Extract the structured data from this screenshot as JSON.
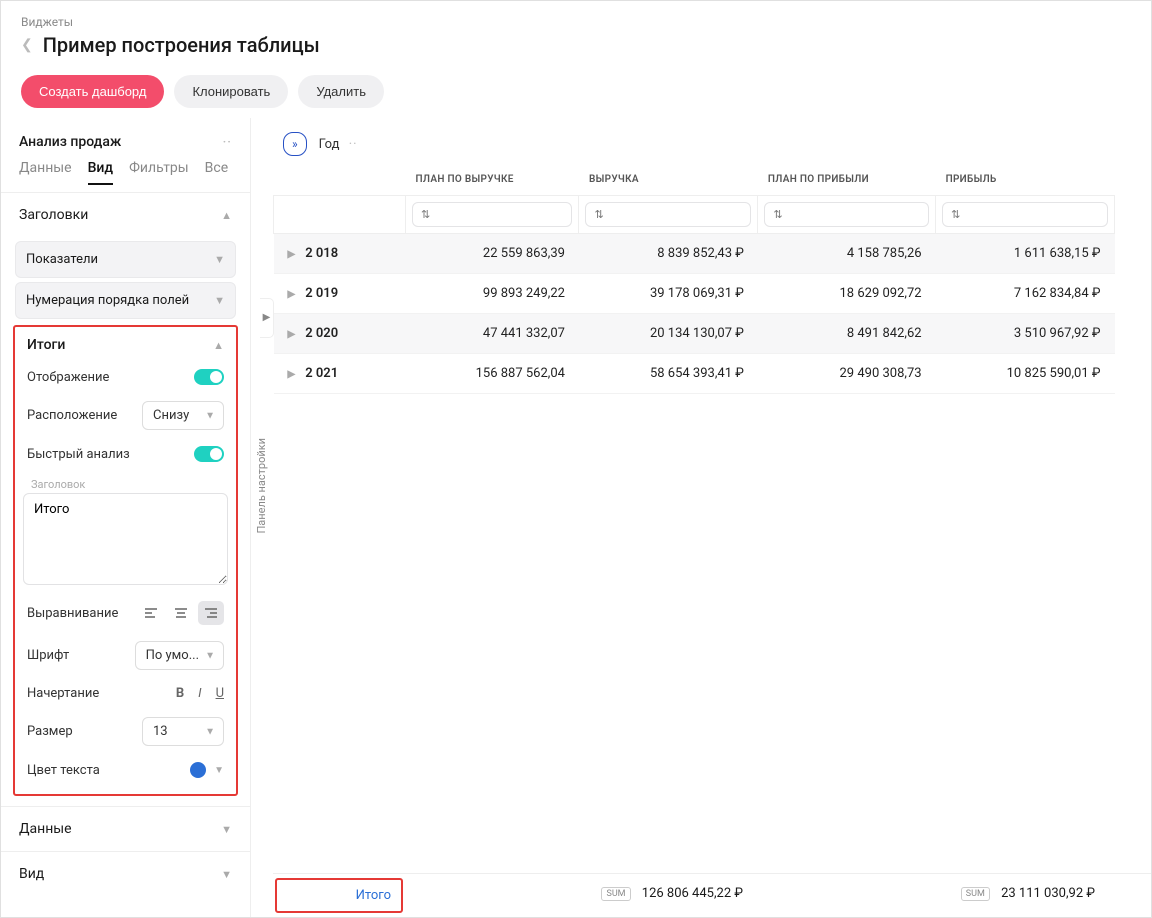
{
  "breadcrumb": "Виджеты",
  "page_title": "Пример построения таблицы",
  "buttons": {
    "create": "Создать дашборд",
    "clone": "Клонировать",
    "delete": "Удалить"
  },
  "sidebar": {
    "title": "Анализ продаж",
    "tabs": {
      "data": "Данные",
      "view": "Вид",
      "filters": "Фильтры",
      "all": "Все"
    },
    "sections": {
      "headers": "Заголовки",
      "measures": "Показатели",
      "numbering": "Нумерация порядка полей",
      "totals": "Итоги",
      "data": "Данные",
      "view2": "Вид"
    },
    "totals": {
      "display": "Отображение",
      "position": "Расположение",
      "position_value": "Снизу",
      "quick": "Быстрый анализ",
      "heading_label": "Заголовок",
      "heading_value": "Итого",
      "align": "Выравнивание",
      "font": "Шрифт",
      "font_value": "По умо...",
      "face": "Начертание",
      "size": "Размер",
      "size_value": "13",
      "text_color": "Цвет текста"
    }
  },
  "collapse_label": "Панель настройки",
  "toolbar": {
    "year": "Год"
  },
  "columns": {
    "plan_rev": "ПЛАН ПО ВЫРУЧКЕ",
    "rev": "ВЫРУЧКА",
    "plan_profit": "ПЛАН ПО ПРИБЫЛИ",
    "profit": "ПРИБЫЛЬ"
  },
  "rows": [
    {
      "year": "2 018",
      "c1": "22 559 863,39",
      "c2": "8 839 852,43 ₽",
      "c3": "4 158 785,26",
      "c4": "1 611 638,15 ₽"
    },
    {
      "year": "2 019",
      "c1": "99 893 249,22",
      "c2": "39 178 069,31 ₽",
      "c3": "18 629 092,72",
      "c4": "7 162 834,84 ₽"
    },
    {
      "year": "2 020",
      "c1": "47 441 332,07",
      "c2": "20 134 130,07 ₽",
      "c3": "8 491 842,62",
      "c4": "3 510 967,92 ₽"
    },
    {
      "year": "2 021",
      "c1": "156 887 562,04",
      "c2": "58 654 393,41 ₽",
      "c3": "29 490 308,73",
      "c4": "10 825 590,01 ₽"
    }
  ],
  "footer": {
    "label": "Итого",
    "sum_badge": "SUM",
    "rev_total": "126 806 445,22 ₽",
    "profit_total": "23 111 030,92 ₽"
  }
}
